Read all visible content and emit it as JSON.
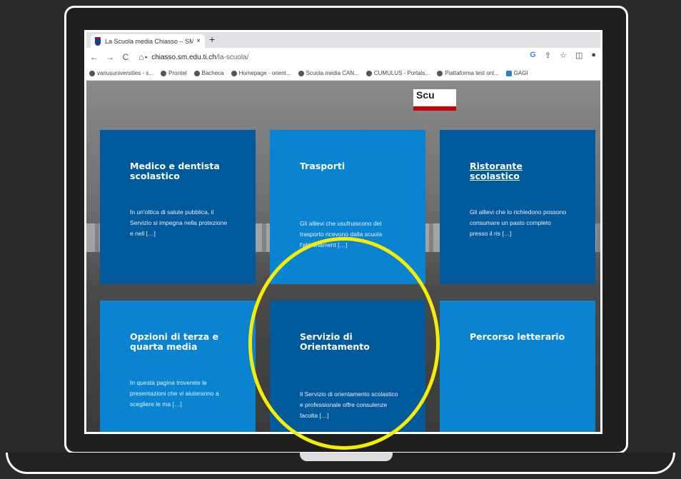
{
  "browser": {
    "tab_title": "La Scuola media Chiasso – SM C",
    "tab_close": "×",
    "new_tab": "+",
    "nav": {
      "back": "←",
      "forward": "→",
      "reload": "C",
      "home": "⌂"
    },
    "url_host": "chiasso.sm.edu.ti.ch",
    "url_path": "/la-scuola/",
    "toolbar_icons": {
      "google": "G",
      "share": "⇪",
      "star": "☆",
      "sidepanel": "◫",
      "profile": "●"
    },
    "bookmarks": [
      "variusuniversities - s...",
      "Prontel",
      "Bacheca",
      "Homepage - orient...",
      "Scuola media CAN...",
      "CUMULUS - Portals...",
      "Piattaforma test onl...",
      "GAGI"
    ]
  },
  "page": {
    "sign_text": "Scu",
    "cards": [
      {
        "title": "Medico e dentista scolastico",
        "text": "In un'ottica di salute pubblica, il Servizio si impegna nella protezione e nell […]"
      },
      {
        "title": "Trasporti",
        "text": "Gli allievi che usufruiscono del trasporto ricevono dalla scuola l'abbonament […]"
      },
      {
        "title": "Ristorante scolastico",
        "text": "Gli allievi che lo richiedono possono consumare un pasto completo presso il ris […]"
      },
      {
        "title": "Opzioni di terza e quarta media",
        "text": "In questa pagina troverete le presentazioni che vi aiuteranno a scegliere le ma […]"
      },
      {
        "title": "Servizio di Orientamento",
        "text": "Il Servizio di orientamento scolastico e professionale offre consulenze facolta […]"
      },
      {
        "title": "Percorso letterario",
        "text": ""
      }
    ]
  },
  "colors": {
    "highlight": "#f5ee00",
    "card_dark": "#005a9c",
    "card_light": "#0a84d0"
  }
}
